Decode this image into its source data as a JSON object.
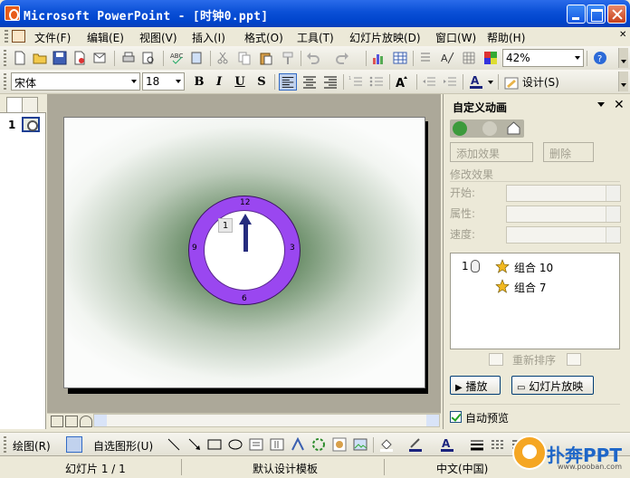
{
  "window": {
    "title": "Microsoft PowerPoint - [时钟0.ppt]"
  },
  "menu": {
    "items": [
      "文件(F)",
      "编辑(E)",
      "视图(V)",
      "插入(I)",
      "格式(O)",
      "工具(T)",
      "幻灯片放映(D)",
      "窗口(W)",
      "帮助(H)"
    ]
  },
  "standard_toolbar": {
    "zoom": "42%"
  },
  "formatting_toolbar": {
    "font": "宋体",
    "size": "18",
    "design_label": "设计(S)"
  },
  "outline_pane": {
    "slide_number": "1"
  },
  "slide": {
    "clock_numbers": {
      "top": "12",
      "right": "3",
      "bottom": "6",
      "left": "9"
    },
    "animation_tag": "1",
    "colors": {
      "ring": "#9a47f0",
      "hand": "#262c7e",
      "glow": "#2f5c2f"
    }
  },
  "task_pane": {
    "title": "自定义动画",
    "add_effect": "添加效果",
    "delete": "删除",
    "modify_section": "修改效果",
    "start_label": "开始:",
    "property_label": "属性:",
    "speed_label": "速度:",
    "animations": [
      {
        "order": "1",
        "name": "组合 10"
      },
      {
        "order": "",
        "name": "组合 7"
      }
    ],
    "reorder": "重新排序",
    "play": "播放",
    "slideshow": "幻灯片放映",
    "autopreview": "自动预览"
  },
  "drawing_toolbar": {
    "draw": "绘图(R)",
    "autoshapes": "自选图形(U)"
  },
  "status": {
    "slide": "幻灯片 1 / 1",
    "design": "默认设计模板",
    "language": "中文(中国)"
  },
  "watermark": {
    "brand": "扑奔PPT",
    "url": "www.pooban.com"
  }
}
